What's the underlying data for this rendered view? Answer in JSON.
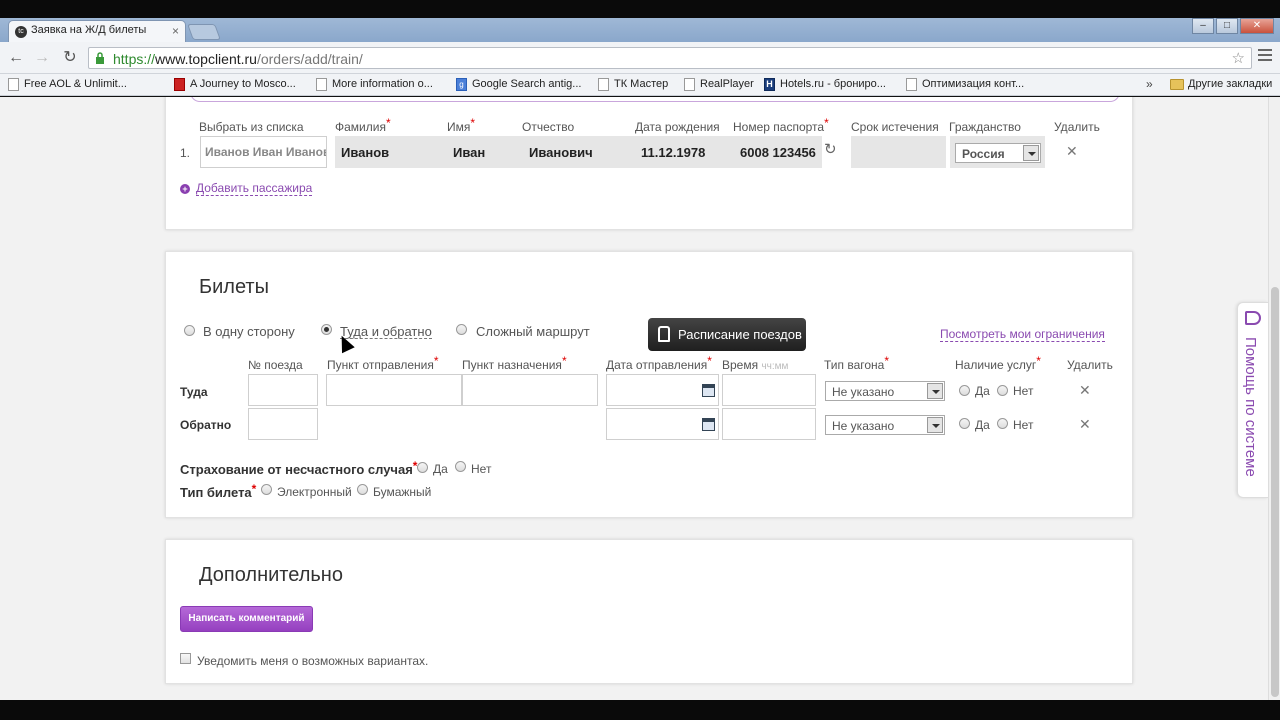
{
  "browser": {
    "tab_title": "Заявка на Ж/Д билеты",
    "tab_icon": "tc-logo-icon",
    "url_scheme": "https://",
    "url_host": "www.topclient.ru",
    "url_path": "/orders/add/train/",
    "bookmarks": [
      {
        "label": "Free AOL & Unlimit..."
      },
      {
        "label": "A Journey to Mosco..."
      },
      {
        "label": "More information o..."
      },
      {
        "label": "Google Search antig..."
      },
      {
        "label": "ТК Мастер"
      },
      {
        "label": "RealPlayer"
      },
      {
        "label": "Hotels.ru - брониро..."
      },
      {
        "label": "Оптимизация конт..."
      }
    ],
    "bookmarks_more": "»",
    "other_bookmarks": "Другие закладки"
  },
  "passengers": {
    "headers": {
      "pick": "Выбрать из списка",
      "last_name": "Фамилия",
      "first_name": "Имя",
      "patronymic": "Отчество",
      "birth_date": "Дата рождения",
      "passport": "Номер паспорта",
      "expiry": "Срок истечения",
      "citizenship": "Гражданство",
      "delete": "Удалить"
    },
    "row": {
      "index": "1.",
      "pick_value": "Иванов Иван Иванович",
      "last_name": "Иванов",
      "first_name": "Иван",
      "patronymic": "Иванович",
      "birth_date": "11.12.1978",
      "passport": "6008 123456",
      "citizenship": "Россия"
    },
    "add_label": "Добавить пассажира"
  },
  "tickets": {
    "title": "Билеты",
    "trip_types": {
      "one_way": "В одну сторону",
      "round_trip": "Туда и обратно",
      "complex": "Сложный маршрут"
    },
    "schedule_button": "Расписание поездов",
    "limits_link": "Посмотреть мои ограничения",
    "headers": {
      "train_no": "№ поезда",
      "departure": "Пункт отправления",
      "destination": "Пункт назначения",
      "dep_date": "Дата отправления",
      "time": "Время",
      "time_hint": "чч:мм",
      "car_type": "Тип вагона",
      "services": "Наличие услуг",
      "delete": "Удалить"
    },
    "rows": {
      "there": "Туда",
      "back": "Обратно"
    },
    "car_type_value": "Не указано",
    "yes": "Да",
    "no": "Нет",
    "insurance_label": "Страхование от несчастного случая",
    "ticket_type_label": "Тип билета",
    "electronic": "Электронный",
    "paper": "Бумажный"
  },
  "extra": {
    "title": "Дополнительно",
    "comment_button": "Написать комментарий",
    "notify_label": "Уведомить меня о возможных вариантах."
  },
  "help": {
    "label": "Помощь по системе"
  }
}
